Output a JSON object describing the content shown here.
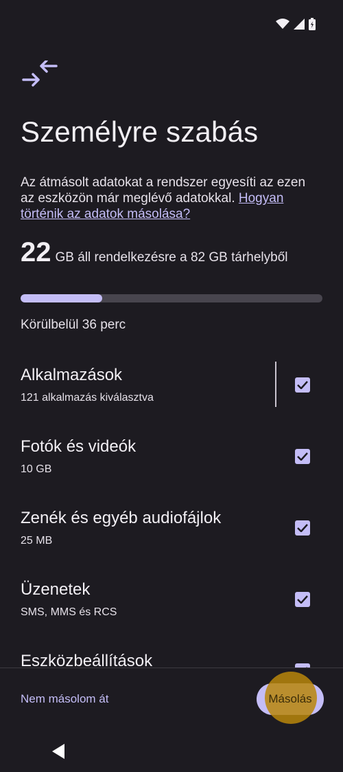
{
  "status_icons": [
    "wifi-icon",
    "cellular-signal-icon",
    "battery-icon"
  ],
  "header": {
    "icon": "transfer-arrows-icon",
    "title": "Személyre szabás"
  },
  "description": {
    "text": "Az átmásolt adatokat a rendszer egyesíti az ezen az eszközön már meglévő adatokkal. ",
    "link": "Hogyan történik az adatok másolása?"
  },
  "storage": {
    "available": "22",
    "text": "GB áll rendelkezésre a 82 GB tárhelyből",
    "progress_fraction": 0.27
  },
  "eta": "Körülbelül 36 perc",
  "items": [
    {
      "label": "Alkalmazások",
      "sub": "121 alkalmazás kiválasztva",
      "checked": true
    },
    {
      "label": "Fotók és videók",
      "sub": "10 GB",
      "checked": true
    },
    {
      "label": "Zenék és egyéb audiofájlok",
      "sub": "25 MB",
      "checked": true
    },
    {
      "label": "Üzenetek",
      "sub": "SMS, MMS és RCS",
      "checked": true
    },
    {
      "label": "Eszközbeállítások",
      "sub": "",
      "checked": true
    }
  ],
  "actions": {
    "skip": "Nem másolom át",
    "copy": "Másolás"
  },
  "colors": {
    "background": "#1d1b21",
    "accent": "#c4bdf7",
    "highlight": "#b8860b"
  }
}
